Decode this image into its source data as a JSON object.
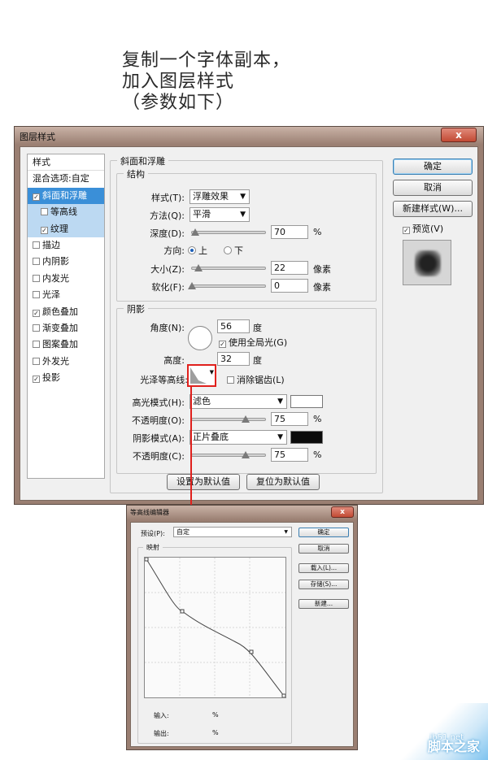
{
  "caption": {
    "line1": "复制一个字体副本，",
    "line2": "加入图层样式",
    "line3": "（参数如下）"
  },
  "dialog": {
    "title": "图层样式",
    "close_glyph": "x",
    "styles_header": "样式",
    "blend_options": "混合选项:自定",
    "style_items": [
      {
        "label": "斜面和浮雕",
        "checked": true
      },
      {
        "label": "等高线",
        "checked": false
      },
      {
        "label": "纹理",
        "checked": true
      },
      {
        "label": "描边",
        "checked": false
      },
      {
        "label": "内阴影",
        "checked": false
      },
      {
        "label": "内发光",
        "checked": false
      },
      {
        "label": "光泽",
        "checked": false
      },
      {
        "label": "颜色叠加",
        "checked": true
      },
      {
        "label": "渐变叠加",
        "checked": false
      },
      {
        "label": "图案叠加",
        "checked": false
      },
      {
        "label": "外发光",
        "checked": false
      },
      {
        "label": "投影",
        "checked": true
      }
    ],
    "check_glyph": "✓",
    "bevel": {
      "title": "斜面和浮雕",
      "structure_title": "结构",
      "style_label": "样式(T):",
      "style_value": "浮雕效果",
      "method_label": "方法(Q):",
      "method_value": "平滑",
      "depth_label": "深度(D):",
      "depth_value": "70",
      "depth_unit": "%",
      "direction_label": "方向:",
      "dir_up": "上",
      "dir_down": "下",
      "size_label": "大小(Z):",
      "size_value": "22",
      "size_unit": "像素",
      "soften_label": "软化(F):",
      "soften_value": "0",
      "soften_unit": "像素"
    },
    "shading": {
      "title": "阴影",
      "angle_label": "角度(N):",
      "angle_value": "56",
      "angle_unit": "度",
      "global_light": "使用全局光(G)",
      "altitude_label": "高度:",
      "altitude_value": "32",
      "altitude_unit": "度",
      "gloss_label": "光泽等高线:",
      "antialias": "消除锯齿(L)",
      "highlight_mode_label": "高光模式(H):",
      "highlight_mode_value": "滤色",
      "highlight_opacity_label": "不透明度(O):",
      "highlight_opacity_value": "75",
      "highlight_color": "#ffffff",
      "shadow_mode_label": "阴影模式(A):",
      "shadow_mode_value": "正片叠底",
      "shadow_opacity_label": "不透明度(C):",
      "shadow_opacity_value": "75",
      "shadow_color": "#0a0a0a",
      "pct": "%"
    },
    "buttons": {
      "make_default": "设置为默认值",
      "reset_default": "复位为默认值",
      "ok": "确定",
      "cancel": "取消",
      "new_style": "新建样式(W)...",
      "preview": "预览(V)"
    }
  },
  "contour_editor": {
    "title": "等高线编辑器",
    "preset_label": "预设(P):",
    "preset_value": "自定",
    "mapping_title": "映射",
    "input_label": "输入:",
    "output_label": "输出:",
    "pct": "%",
    "buttons": {
      "ok": "确定",
      "cancel": "取消",
      "load": "载入(L)...",
      "save": "存储(S)...",
      "new": "新建..."
    }
  },
  "watermark": {
    "url": "jb51.net",
    "name": "脚本之家"
  }
}
